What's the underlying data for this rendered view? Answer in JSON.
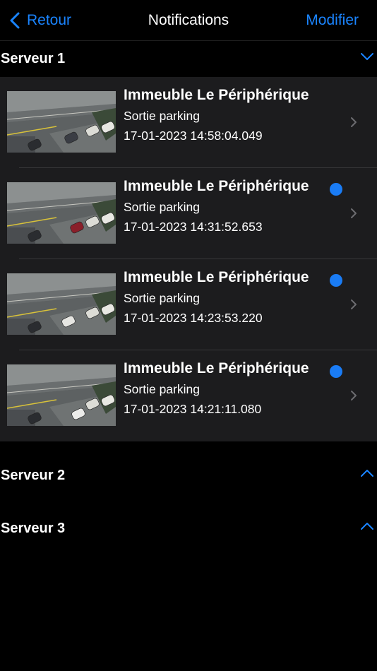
{
  "navbar": {
    "back_label": "Retour",
    "title": "Notifications",
    "edit_label": "Modifier"
  },
  "sections": [
    {
      "label": "Serveur 1",
      "expanded": true,
      "chevron": "chevron-down-icon"
    },
    {
      "label": "Serveur 2",
      "expanded": false,
      "chevron": "chevron-up-icon"
    },
    {
      "label": "Serveur 3",
      "expanded": false,
      "chevron": "chevron-up-icon"
    }
  ],
  "notifications": [
    {
      "title": "Immeuble Le Périphérique",
      "subtitle": "Sortie parking",
      "timestamp": "17-01-2023 14:58:04.049",
      "unread": false
    },
    {
      "title": "Immeuble Le Périphérique",
      "subtitle": "Sortie parking",
      "timestamp": "17-01-2023 14:31:52.653",
      "unread": true
    },
    {
      "title": "Immeuble Le Périphérique",
      "subtitle": "Sortie parking",
      "timestamp": "17-01-2023 14:23:53.220",
      "unread": true
    },
    {
      "title": "Immeuble Le Périphérique",
      "subtitle": "Sortie parking",
      "timestamp": "17-01-2023 14:21:11.080",
      "unread": true
    }
  ],
  "colors": {
    "accent": "#1a84ff",
    "unread_dot": "#1a7cf5",
    "background": "#000000",
    "cell_background": "#1c1c1e"
  }
}
